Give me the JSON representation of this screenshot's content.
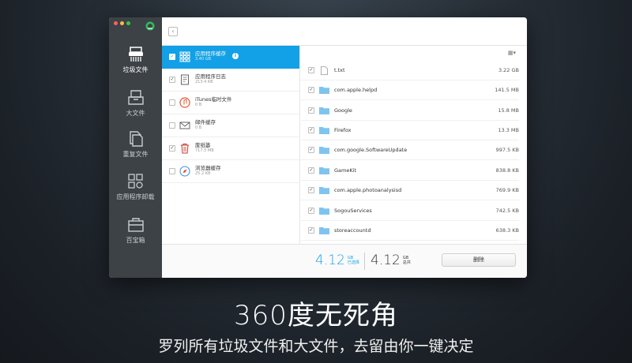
{
  "sidebar": {
    "items": [
      {
        "label": "垃圾文件",
        "icon": "shredder-icon"
      },
      {
        "label": "大文件",
        "icon": "drawer-icon"
      },
      {
        "label": "重复文件",
        "icon": "duplicate-files-icon"
      },
      {
        "label": "应用程序卸载",
        "icon": "apps-gear-icon"
      },
      {
        "label": "百宝箱",
        "icon": "toolbox-icon"
      }
    ]
  },
  "categories": [
    {
      "name": "应用程序缓存",
      "size": "3.40 GB",
      "checked": true
    },
    {
      "name": "应用程序日志",
      "size": "213.4 KB",
      "checked": true
    },
    {
      "name": "iTunes临时文件",
      "size": "0 B",
      "checked": false
    },
    {
      "name": "邮件缓存",
      "size": "0 B",
      "checked": false
    },
    {
      "name": "废纸篓",
      "size": "717.5 MB",
      "checked": true
    },
    {
      "name": "浏览器缓存",
      "size": "25.2 KB",
      "checked": false
    }
  ],
  "files": [
    {
      "name": "t.txt",
      "size": "3.22 GB",
      "type": "file"
    },
    {
      "name": "com.apple.helpd",
      "size": "141.5 MB",
      "type": "folder"
    },
    {
      "name": "Google",
      "size": "15.8 MB",
      "type": "folder"
    },
    {
      "name": "Firefox",
      "size": "13.3 MB",
      "type": "folder"
    },
    {
      "name": "com.google.SoftwareUpdate",
      "size": "997.5 KB",
      "type": "folder"
    },
    {
      "name": "GameKit",
      "size": "838.8 KB",
      "type": "folder"
    },
    {
      "name": "com.apple.photoanalysisd",
      "size": "769.9 KB",
      "type": "folder"
    },
    {
      "name": "SogouServices",
      "size": "742.5 KB",
      "type": "folder"
    },
    {
      "name": "storeaccountd",
      "size": "638.3 KB",
      "type": "folder"
    }
  ],
  "summary": {
    "selected_value": "4.12",
    "selected_unit": "GB",
    "selected_label": "已选择",
    "total_value": "4.12",
    "total_unit": "GB",
    "total_label": "总共",
    "delete_label": "删除"
  },
  "colors": {
    "accent": "#12a0e6",
    "sidebar": "#3d4246",
    "folder": "#7fc4ee"
  },
  "marketing": {
    "headline": "360度无死角",
    "subline": "罗列所有垃圾文件和大文件，去留由你一键决定"
  }
}
